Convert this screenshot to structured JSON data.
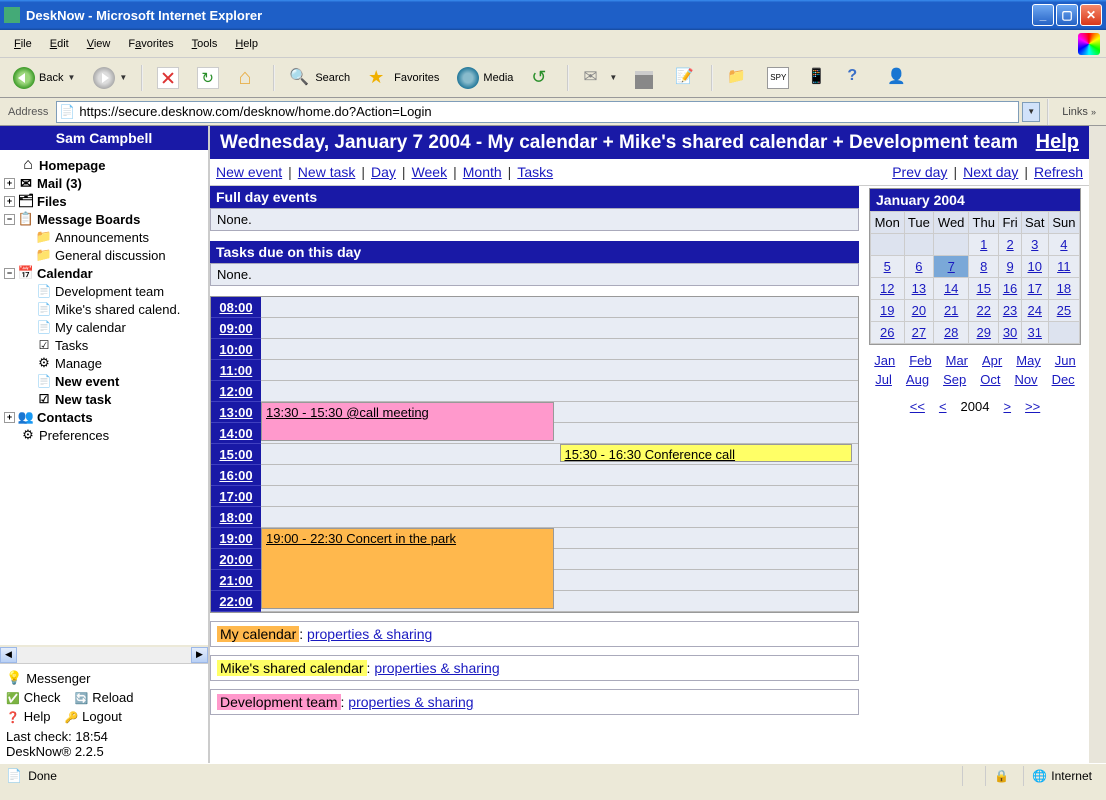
{
  "window": {
    "title": "DeskNow - Microsoft Internet Explorer"
  },
  "menubar": [
    "File",
    "Edit",
    "View",
    "Favorites",
    "Tools",
    "Help"
  ],
  "toolbar": {
    "back": "Back",
    "search": "Search",
    "favorites": "Favorites",
    "media": "Media",
    "spy": "SPY"
  },
  "address": {
    "label": "Address",
    "url": "https://secure.desknow.com/desknow/home.do?Action=Login",
    "links": "Links"
  },
  "sidebar": {
    "user": "Sam Campbell",
    "items": {
      "homepage": "Homepage",
      "mail": "Mail (3)",
      "files": "Files",
      "boards": "Message Boards",
      "announcements": "Announcements",
      "general": "General discussion",
      "calendar": "Calendar",
      "devteam": "Development team",
      "mikecal": "Mike's shared calend.",
      "mycal": "My calendar",
      "tasks": "Tasks",
      "manage": "Manage",
      "newevent": "New event",
      "newtask": "New task",
      "contacts": "Contacts",
      "prefs": "Preferences"
    },
    "messenger": "Messenger",
    "check": "Check",
    "reload": "Reload",
    "help": "Help",
    "logout": "Logout",
    "lastcheck": "Last check: 18:54",
    "version": "DeskNow® 2.2.5"
  },
  "main": {
    "title": "Wednesday, January 7 2004 - My calendar + Mike's shared calendar + Development team",
    "help": "Help",
    "actions": {
      "newevent": "New event",
      "newtask": "New task",
      "day": "Day",
      "week": "Week",
      "month": "Month",
      "tasks": "Tasks",
      "prevday": "Prev day",
      "nextday": "Next day",
      "refresh": "Refresh"
    },
    "fullday": {
      "header": "Full day events",
      "none": "None."
    },
    "taskdue": {
      "header": "Tasks due on this day",
      "none": "None."
    },
    "hours": [
      "08:00",
      "09:00",
      "10:00",
      "11:00",
      "12:00",
      "13:00",
      "14:00",
      "15:00",
      "16:00",
      "17:00",
      "18:00",
      "19:00",
      "20:00",
      "21:00",
      "22:00"
    ],
    "events": {
      "e1": "13:30 - 15:30 @call meeting",
      "e2": "15:30 - 16:30 Conference call",
      "e3": "19:00 - 22:30 Concert in the park"
    },
    "minical": {
      "header": "January 2004",
      "dow": [
        "Mon",
        "Tue",
        "Wed",
        "Thu",
        "Fri",
        "Sat",
        "Sun"
      ],
      "months": [
        "Jan",
        "Feb",
        "Mar",
        "Apr",
        "May",
        "Jun",
        "Jul",
        "Aug",
        "Sep",
        "Oct",
        "Nov",
        "Dec"
      ],
      "year": "2004",
      "nav": {
        "pprev": "<<",
        "prev": "<",
        "next": ">",
        "nnext": ">>"
      }
    },
    "legend": {
      "mycal": "My calendar",
      "mike": "Mike's shared calendar",
      "dev": "Development team",
      "props": "properties & sharing"
    }
  },
  "status": {
    "done": "Done",
    "zone": "Internet"
  }
}
